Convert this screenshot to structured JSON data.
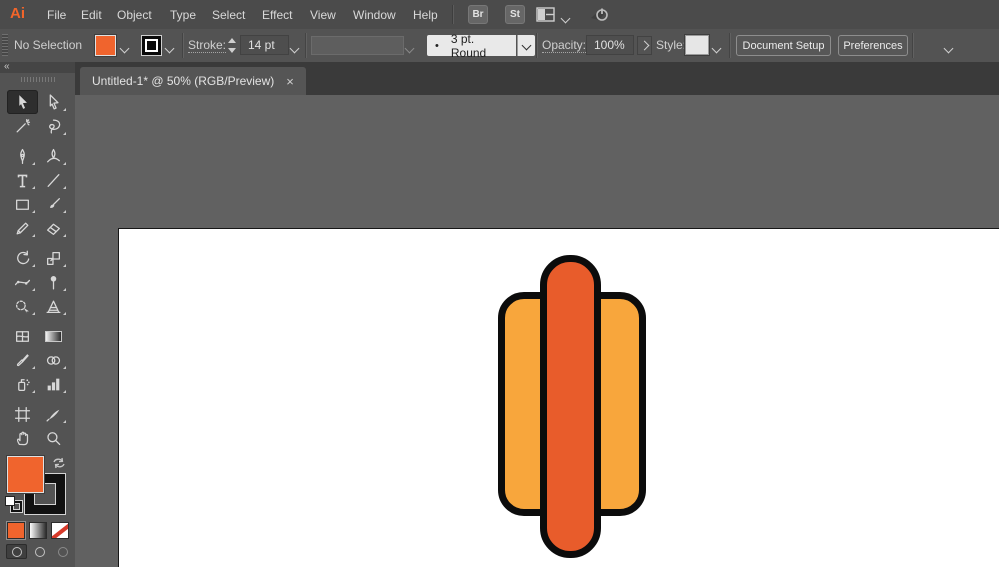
{
  "menu_bar": {
    "logo": "Ai",
    "items": [
      "File",
      "Edit",
      "Object",
      "Type",
      "Select",
      "Effect",
      "View",
      "Window",
      "Help"
    ],
    "bridge_label": "Br",
    "stock_label": "St"
  },
  "control_bar": {
    "selection_status": "No Selection",
    "stroke_label": "Stroke:",
    "stroke_value": "14 pt",
    "brush_bullet": "•",
    "brush_value": "3 pt. Round",
    "opacity_label": "Opacity:",
    "opacity_value": "100%",
    "style_label": "Style:",
    "document_setup_label": "Document Setup",
    "preferences_label": "Preferences"
  },
  "document_tab": {
    "title": "Untitled-1* @ 50% (RGB/Preview)",
    "close_glyph": "×"
  },
  "tool_panel": {
    "collapse_glyph": "«",
    "tools": [
      "selection",
      "direct-selection",
      "magic-wand",
      "lasso",
      "pen",
      "curvature",
      "type",
      "line-segment",
      "rectangle",
      "paintbrush",
      "shaper",
      "eraser",
      "rotate",
      "scale",
      "width",
      "puppet-warp",
      "shape-builder",
      "perspective-grid",
      "mesh",
      "gradient",
      "eyedropper",
      "blend",
      "symbol-sprayer",
      "column-graph",
      "artboard",
      "slice",
      "hand",
      "zoom"
    ],
    "active_tool": "selection"
  },
  "icons": {
    "menu_right": [
      "bridge-button",
      "stock-button",
      "workspace-layout-icon",
      "chevron-down-icon",
      "touch-workspace-icon"
    ],
    "control_right": [
      "selection-options-icon",
      "chevron-down-icon"
    ],
    "tool_panel_misc": [
      "swap-fill-stroke-icon",
      "default-fill-stroke-icon",
      "color-button",
      "gradient-button",
      "none-button",
      "draw-normal-mode-icon",
      "draw-behind-mode-icon",
      "draw-inside-mode-icon"
    ]
  },
  "colors": {
    "accent_orange": "#F0642D",
    "sausage": "#E85C2B",
    "bun": "#F8A63C",
    "outline": "#0C0C0C",
    "artboard_white": "#FFFFFF",
    "pasteboard_gray": "#616161",
    "none_red": "#D63A2A"
  }
}
